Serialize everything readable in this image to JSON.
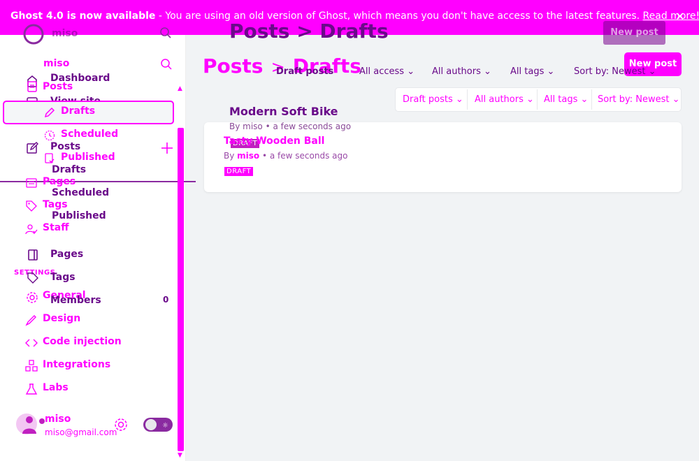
{
  "banner": {
    "version_text": "Ghost 4.0 is now available",
    "message": " - You are using an old version of Ghost, which means you don't have access to the latest features. ",
    "read_more": "Read more!",
    "close_glyph": "✕"
  },
  "sidebar": {
    "site_name": "miso",
    "ghost_site_name": "miso",
    "ghost_nav": [
      "Dashboard",
      "View site",
      "Posts",
      "Drafts",
      "Scheduled",
      "Published",
      "Pages",
      "Tags",
      "Members"
    ],
    "ghost_members_count": "0",
    "nav": {
      "posts": "Posts",
      "drafts": "Drafts",
      "scheduled": "Scheduled",
      "published": "Published",
      "pages": "Pages",
      "tags": "Tags",
      "staff": "Staff"
    },
    "settings_heading": "SETTINGS",
    "settings": {
      "general": "General",
      "design": "Design",
      "code_injection": "Code injection",
      "integrations": "Integrations",
      "labs": "Labs"
    },
    "user": {
      "name": "miso",
      "email": "miso@gmail.com"
    }
  },
  "main": {
    "breadcrumb_parent": "Posts",
    "breadcrumb_sep": ">",
    "breadcrumb_current": "Drafts",
    "ghost_breadcrumb": "Posts > Drafts",
    "new_post_label": "New post",
    "ghost_filters": [
      "Draft posts",
      "All access",
      "All authors",
      "All tags",
      "Sort by: Newest"
    ],
    "filters": [
      "Draft posts",
      "All authors",
      "All tags",
      "Sort by: Newest"
    ],
    "ghost_post": {
      "title": "Modern Soft Bike",
      "meta": "By miso • a few seconds ago",
      "badge": "DRAFT"
    },
    "post": {
      "title": "Tasty Wooden Ball",
      "by": "By ",
      "author": "miso",
      "time": " • a few seconds ago",
      "badge": "DRAFT"
    }
  },
  "colors": {
    "accent": "#ff00ff",
    "ghost": "#6a0a8a",
    "background": "#f1f3f5"
  }
}
